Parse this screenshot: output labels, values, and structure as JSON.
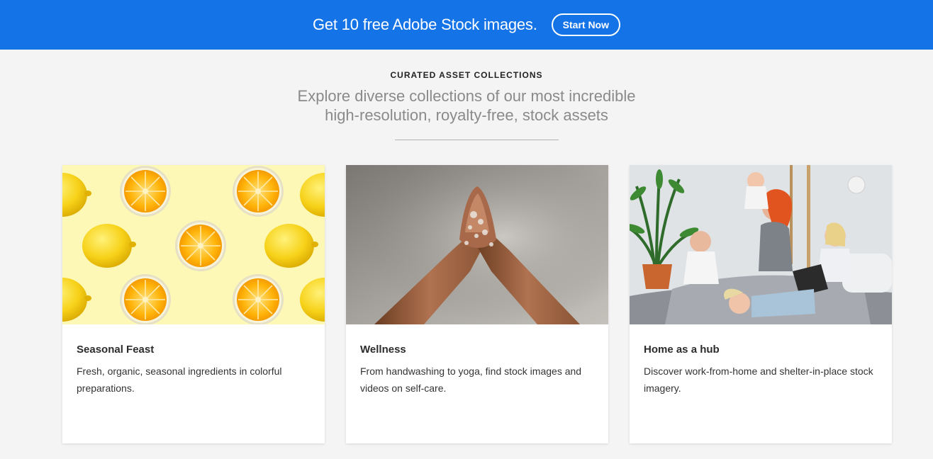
{
  "banner": {
    "text": "Get 10 free Adobe Stock images.",
    "button_label": "Start Now",
    "background_color": "#1473e6"
  },
  "section": {
    "eyebrow": "CURATED ASSET COLLECTIONS",
    "subtitle_line1": "Explore diverse collections of our most incredible",
    "subtitle_line2": "high-resolution, royalty-free, stock assets"
  },
  "cards": [
    {
      "title": "Seasonal Feast",
      "description": "Fresh, organic, seasonal ingredients in colorful preparations.",
      "image": "lemons-pattern"
    },
    {
      "title": "Wellness",
      "description": "From handwashing to yoga, find stock images and videos on self-care.",
      "image": "washing-hands"
    },
    {
      "title": "Home as a hub",
      "description": "Discover work-from-home and shelter-in-place stock imagery.",
      "image": "family-at-home"
    }
  ]
}
